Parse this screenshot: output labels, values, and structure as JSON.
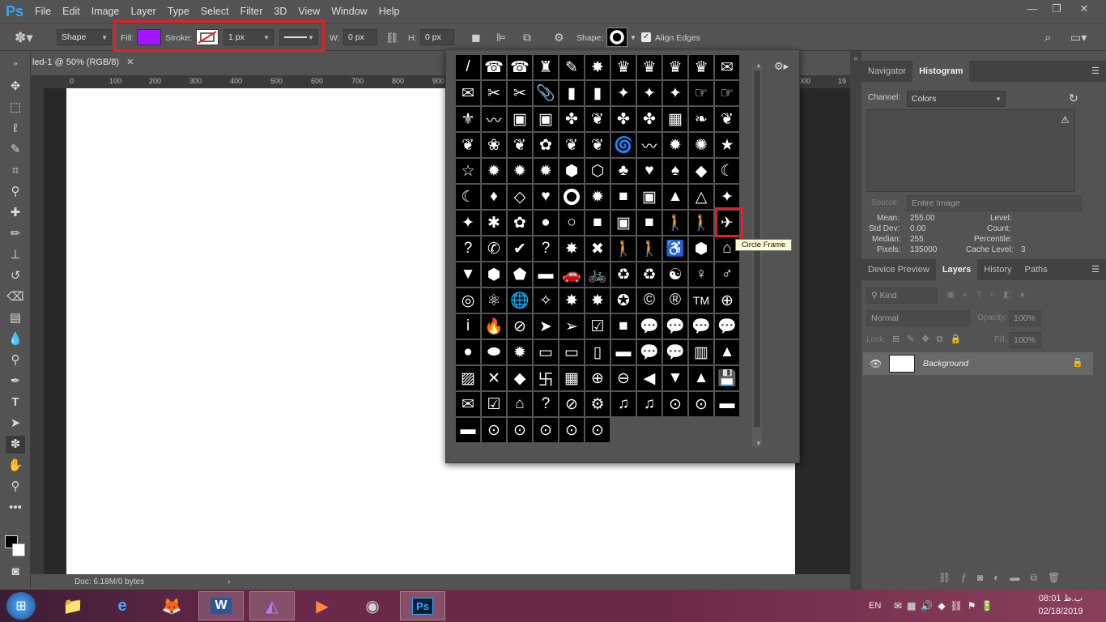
{
  "app": {
    "logo": "Ps"
  },
  "menu": [
    "File",
    "Edit",
    "Image",
    "Layer",
    "Type",
    "Select",
    "Filter",
    "3D",
    "View",
    "Window",
    "Help"
  ],
  "window_controls": {
    "minimize": "—",
    "restore": "❐",
    "close": "✕"
  },
  "options": {
    "mode": "Shape",
    "fill_label": "Fill:",
    "fill_color": "#a314ff",
    "stroke_label": "Stroke:",
    "stroke_width": "1 px",
    "w_label": "W:",
    "w_value": "0 px",
    "h_label": "H:",
    "h_value": "0 px",
    "shape_label": "Shape:",
    "align_edges": "Align Edges"
  },
  "document": {
    "tab_title": "led-1 @ 50% (RGB/8)",
    "ruler_ticks": [
      "0",
      "100",
      "200",
      "300",
      "400",
      "500",
      "600",
      "700",
      "800",
      "900",
      "1000",
      "19"
    ],
    "status": "Doc: 6.18M/0 bytes"
  },
  "shape_picker": {
    "shapes": [
      "/",
      "☎",
      "☎",
      "♜",
      "✎",
      "✸",
      "♛",
      "♛",
      "♛",
      "♛",
      "✉",
      "✉",
      "✂",
      "✂",
      "📎",
      "▮",
      "▮",
      "✦",
      "✦",
      "✦",
      "☞",
      "☞",
      "⚜",
      "〰",
      "▣",
      "▣",
      "✤",
      "❦",
      "✤",
      "✤",
      "▦",
      "❧",
      "❦",
      "❦",
      "❀",
      "❦",
      "✿",
      "❦",
      "❦",
      "🌀",
      "〰",
      "✹",
      "✺",
      "★",
      "☆",
      "✹",
      "✹",
      "✹",
      "⬢",
      "⬡",
      "♣",
      "♥",
      "♠",
      "◆",
      "☾",
      "☾",
      "♦",
      "◇",
      "♥",
      "♡",
      "✹",
      "■",
      "▣",
      "▲",
      "△",
      "✦",
      "✦",
      "✱",
      "✿",
      "●",
      "○",
      "■",
      "▣",
      "■",
      "🚶",
      "🚶",
      "✈",
      "?",
      "✆",
      "✔",
      "?",
      "✸",
      "✖",
      "🚶",
      "🚶",
      "♿",
      "⬢",
      "⌂",
      "▼",
      "⬢",
      "⬟",
      "▬",
      "🚗",
      "🚲",
      "♻",
      "♻",
      "☯",
      "♀",
      "♂",
      "◎",
      "⚛",
      "🌐",
      "✧",
      "✸",
      "✸",
      "✪",
      "©",
      "®",
      "TM",
      "⊕",
      "i",
      "🔥",
      "⊘",
      "➤",
      "➢",
      "☑",
      "■",
      "💬",
      "💬",
      "💬",
      "💬",
      "●",
      "⬬",
      "✹",
      "▭",
      "▭",
      "▯",
      "▬",
      "💬",
      "💬",
      "▥",
      "▲",
      "▨",
      "✕",
      "◆",
      "卐",
      "▦",
      "⊕",
      "⊖",
      "◀",
      "▼",
      "▲",
      "💾",
      "✉",
      "☑",
      "⌂",
      "?",
      "⊘",
      "⚙",
      "♫",
      "♫",
      "⊙",
      "⊙",
      "▬",
      "▬",
      "⊙",
      "⊙",
      "⊙",
      "⊙",
      "⊙"
    ],
    "tooltip": "Circle Frame",
    "menu_icon": "gear-icon"
  },
  "histogram": {
    "tabs": [
      "Navigator",
      "Histogram"
    ],
    "channel_label": "Channel:",
    "channel_value": "Colors",
    "source_label": "Source:",
    "source_value": "Entire Image",
    "stats": {
      "mean_label": "Mean:",
      "mean": "255.00",
      "stddev_label": "Std Dev:",
      "stddev": "0.00",
      "median_label": "Median:",
      "median": "255",
      "pixels_label": "Pixels:",
      "pixels": "135000",
      "level_label": "Level:",
      "count_label": "Count:",
      "percentile_label": "Percentile:",
      "cache_label": "Cache Level:",
      "cache": "3"
    }
  },
  "layers": {
    "tabs": [
      "Device Preview",
      "Layers",
      "History",
      "Paths"
    ],
    "kind": "Kind",
    "blend_mode": "Normal",
    "opacity_label": "Opacity:",
    "opacity_value": "100%",
    "lock_label": "Lock:",
    "fill_label": "Fill:",
    "fill_value": "100%",
    "layer_name": "Background"
  },
  "taskbar": {
    "lang": "EN",
    "time": "08:01 ب.ظ",
    "date": "02/18/2019"
  }
}
